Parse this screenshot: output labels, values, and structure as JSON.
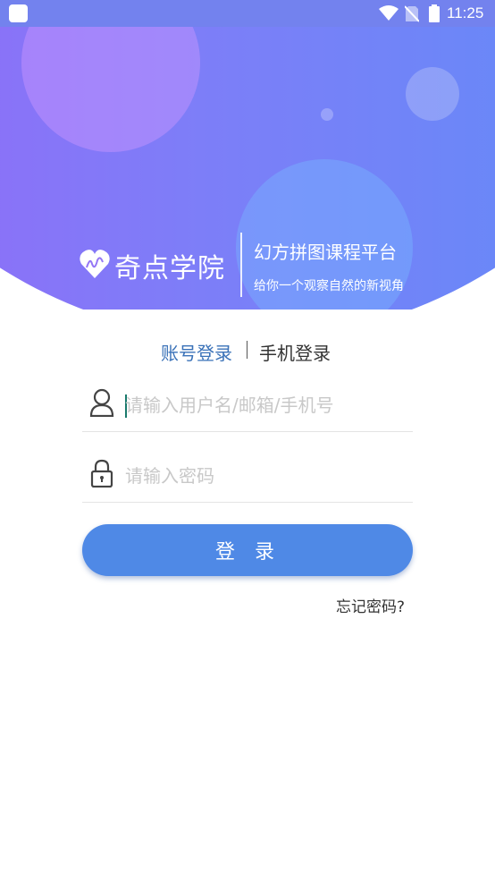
{
  "status_bar": {
    "time": "11:25"
  },
  "brand": {
    "name": "奇点学院",
    "title": "幻方拼图课程平台",
    "slogan": "给你一个观察自然的新视角"
  },
  "tabs": {
    "account": "账号登录",
    "phone": "手机登录"
  },
  "form": {
    "username_placeholder": "请输入用户名/邮箱/手机号",
    "username_value": "",
    "password_placeholder": "请输入密码",
    "password_value": "",
    "login_label": "登录",
    "forgot_label": "忘记密码?"
  },
  "colors": {
    "accent": "#4f89e6",
    "active_tab": "#3a72b8",
    "gradient_start": "#9766f7",
    "gradient_end": "#5d8ef7"
  },
  "icons": [
    "app-notification-icon",
    "wifi-icon",
    "no-sim-icon",
    "battery-icon",
    "brand-logo-icon",
    "user-icon",
    "lock-icon"
  ]
}
